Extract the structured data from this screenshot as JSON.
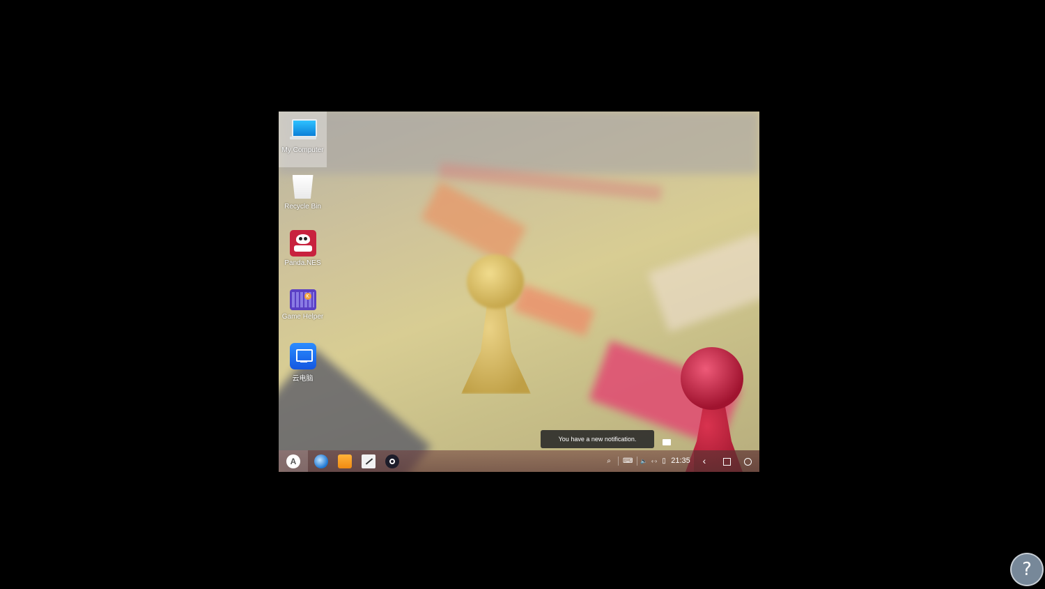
{
  "desktop": {
    "icons": [
      {
        "label": "My Computer",
        "icon": "computer-icon"
      },
      {
        "label": "Recycle Bin",
        "icon": "trash-icon"
      },
      {
        "label": "Panda.NES",
        "icon": "panda-nes-icon"
      },
      {
        "label": "Game Helper",
        "icon": "keyboard-game-icon"
      },
      {
        "label": "云电脑",
        "icon": "cloud-pc-icon"
      }
    ]
  },
  "toast": {
    "text": "You have a new notification."
  },
  "taskbar": {
    "start_glyph": "A",
    "apps": [
      "browser-icon",
      "folder-icon",
      "notes-icon",
      "media-player-icon"
    ],
    "tray": {
      "search": "⌕",
      "keyboard": "⌨",
      "volume": "🔈",
      "wifi": "‹·›",
      "battery": "▯",
      "clock": "21:35"
    },
    "nav": {
      "back": "‹"
    }
  },
  "watermark": {
    "glyph": "?"
  }
}
